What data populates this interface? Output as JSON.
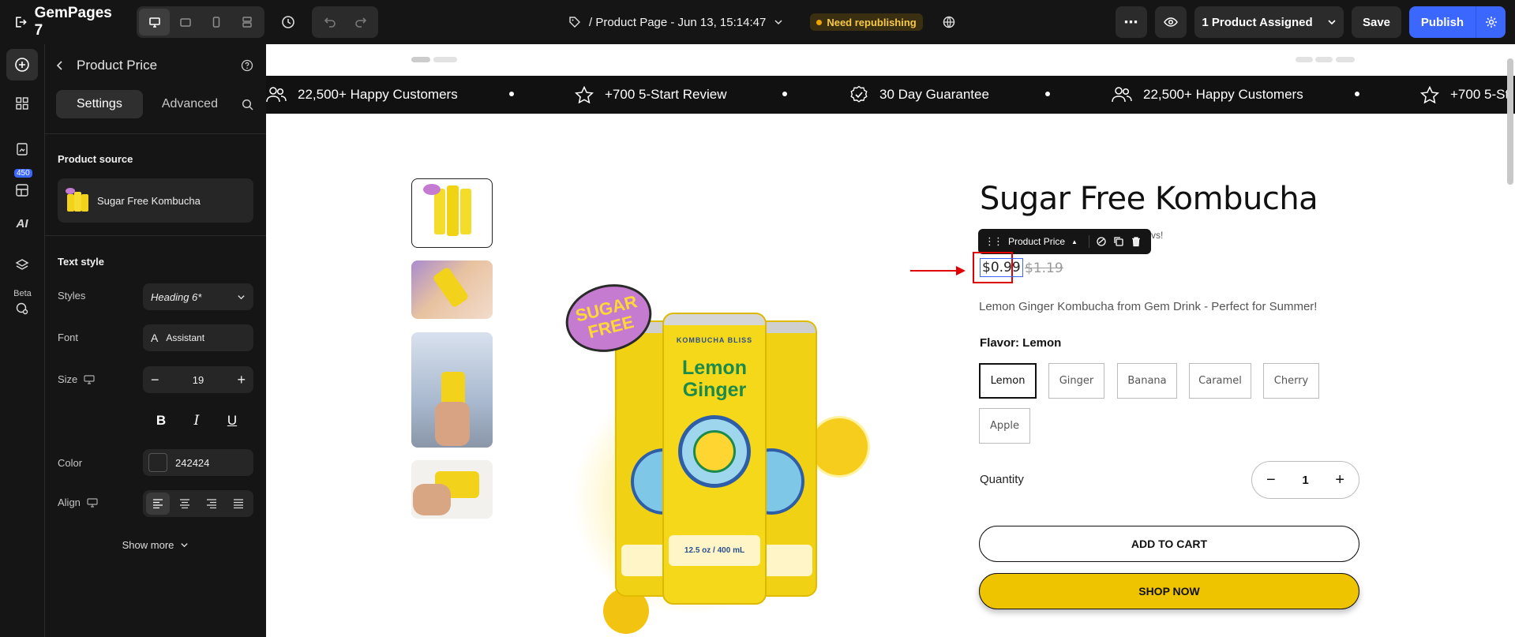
{
  "app": {
    "name": "GemPages 7",
    "page_title": "/ Product Page - Jun 13, 15:14:47",
    "status_badge": "Need republishing"
  },
  "topbar": {
    "assigned_label": "1 Product Assigned",
    "save_label": "Save",
    "publish_label": "Publish"
  },
  "rail": {
    "count_badge": "450",
    "ai_label": "AI",
    "beta_label": "Beta"
  },
  "panel": {
    "title": "Product Price",
    "tabs": [
      "Settings",
      "Advanced"
    ],
    "product_source_label": "Product source",
    "product_name": "Sugar Free Kombucha",
    "text_style_label": "Text style",
    "styles_label": "Styles",
    "styles_value": "Heading 6*",
    "font_label": "Font",
    "font_value": "Assistant",
    "size_label": "Size",
    "size_value": "19",
    "color_label": "Color",
    "color_value": "242424",
    "align_label": "Align",
    "show_more": "Show more"
  },
  "trust_bar": {
    "items": [
      "22,500+ Happy Customers",
      "+700 5-Start Review",
      "30 Day Guarantee",
      "22,500+ Happy Customers",
      "+700 5-St"
    ]
  },
  "product": {
    "title": "Sugar Free Kombucha",
    "reviews_suffix": "vs!",
    "price": "$0.99",
    "compare_price": "$1.19",
    "description": "Lemon Ginger Kombucha from Gem Drink - Perfect for Summer!",
    "flavor_label": "Flavor: Lemon",
    "flavors": [
      "Lemon",
      "Ginger",
      "Banana",
      "Caramel",
      "Cherry",
      "Apple"
    ],
    "quantity_label": "Quantity",
    "quantity_value": "1",
    "add_to_cart": "ADD TO CART",
    "shop_now": "SHOP NOW",
    "sticker_line1": "SUGAR",
    "sticker_line2": "FREE",
    "can_brand": "KOMBUCHA BLISS",
    "can_line1": "Lemon",
    "can_line2": "Ginger",
    "can_volume": "12.5 oz / 400 mL"
  },
  "toolbar_chip": {
    "label": "Product Price"
  },
  "colors": {
    "accent": "#3c67ff",
    "shop_now_bg": "#eec300",
    "text": "#242424",
    "highlight": "#e00000"
  }
}
